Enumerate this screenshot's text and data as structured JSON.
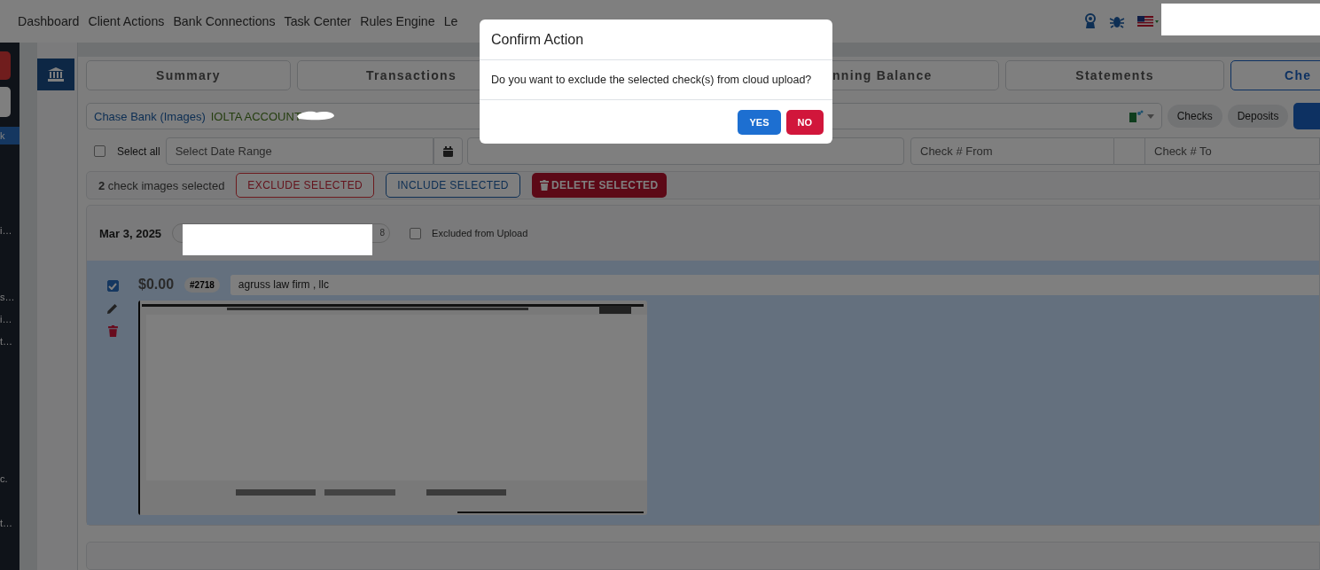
{
  "nav": {
    "links": [
      {
        "label": "Dashboard"
      },
      {
        "label": "Client Actions"
      },
      {
        "label": "Bank Connections"
      },
      {
        "label": "Task Center"
      },
      {
        "label": "Rules Engine"
      },
      {
        "label": "Le"
      }
    ]
  },
  "sidebar": {
    "items": [
      {
        "label": "k",
        "selected": true
      },
      {
        "label": "i…",
        "selected": false
      },
      {
        "label": "s…",
        "selected": false
      },
      {
        "label": "i…",
        "selected": false
      },
      {
        "label": "t…",
        "selected": false
      },
      {
        "label": "c.",
        "selected": false
      },
      {
        "label": "t…",
        "selected": false
      }
    ]
  },
  "tabs": [
    {
      "label": "Summary",
      "selected": false
    },
    {
      "label": "Transactions",
      "selected": false
    },
    {
      "label": "nning Balance",
      "selected": false
    },
    {
      "label": "Statements",
      "selected": false
    },
    {
      "label": "Che",
      "selected": true
    }
  ],
  "account_bar": {
    "bank": "Chase Bank (Images)",
    "account": "IOLTA ACCOUNT",
    "filters": [
      {
        "label": "Checks"
      },
      {
        "label": "Deposits"
      }
    ]
  },
  "filters": {
    "select_all": {
      "label": "Select all",
      "checked": false
    },
    "date_range": {
      "placeholder": "Select Date Range"
    },
    "check_from": {
      "placeholder": "Check # From"
    },
    "check_to": {
      "placeholder": "Check # To"
    }
  },
  "selection_bar": {
    "summary": "**2** check images selected",
    "buttons": [
      {
        "label": "EXCLUDE SELECTED",
        "kind": "exclude"
      },
      {
        "label": "INCLUDE SELECTED",
        "kind": "include"
      },
      {
        "label": "DELETE SELECTED",
        "kind": "delete"
      }
    ]
  },
  "date_groups": [
    {
      "date": "Mar 3, 2025",
      "count": "8",
      "excluded_from_upload": {
        "label": "Excluded from Upload",
        "checked": false
      },
      "checks": [
        {
          "selected": true,
          "amount": "$0.00",
          "number": "#2718",
          "payee": "agruss law firm , llc"
        }
      ]
    }
  ],
  "dialog": {
    "title": "Confirm Action",
    "message": "Do you want to exclude the selected check(s) from cloud upload?",
    "buttons": [
      {
        "label": "YES",
        "kind": "primary"
      },
      {
        "label": "NO",
        "kind": "danger"
      }
    ]
  }
}
